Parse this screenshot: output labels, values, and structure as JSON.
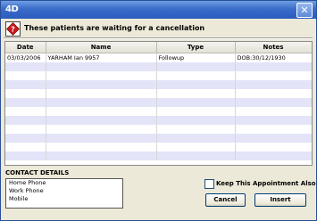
{
  "window": {
    "app_icon_text": "4D",
    "close_glyph": "✕"
  },
  "header": {
    "message": "These patients are waiting for a cancellation",
    "icon": "red-question-diamond-icon"
  },
  "table": {
    "columns": [
      "Date",
      "Name",
      "Type",
      "Notes"
    ],
    "rows": [
      [
        "03/03/2006",
        "YARHAM Ian 9957",
        "Followup",
        "DOB:30/12/1930"
      ]
    ]
  },
  "contact": {
    "title": "CONTACT DETAILS",
    "lines": [
      "Home Phone",
      "Work Phone",
      "Mobile"
    ]
  },
  "keep_appointment": {
    "label": "Keep This Appointment Also",
    "checked": false
  },
  "buttons": {
    "cancel": "Cancel",
    "insert": "Insert"
  },
  "colors": {
    "titlebar": "#3a6cc9",
    "row_alt": "#e3e4f8",
    "dialog_bg": "#ece9d8"
  }
}
